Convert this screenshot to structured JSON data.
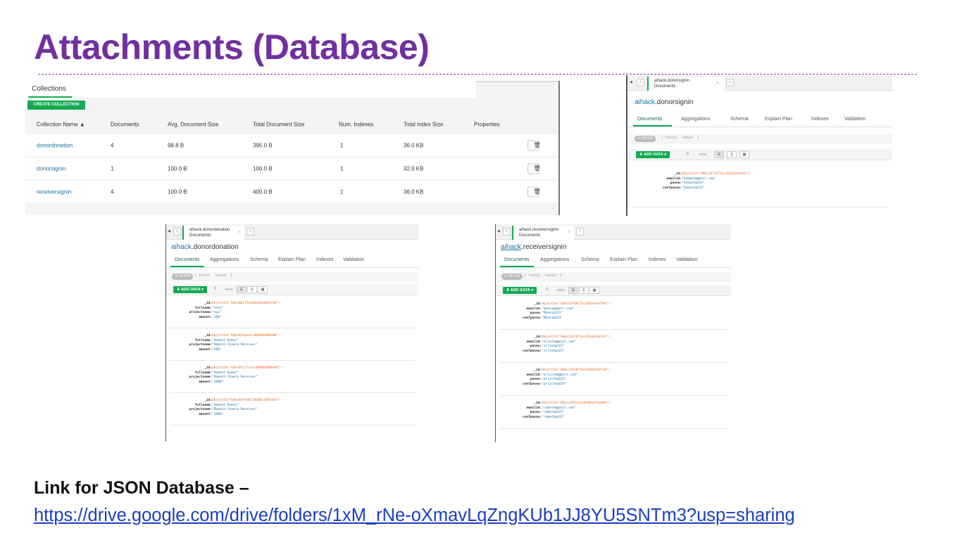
{
  "slide": {
    "title": "Attachments (Database)",
    "link_heading": "Link for JSON Database –",
    "link_url": "https://drive.google.com/drive/folders/1xM_rNe-oXmavLqZngKUb1JJ8YU5SNTm3?usp=sharing"
  },
  "collections": {
    "tab_label": "Collections",
    "create_button": "CREATE COLLECTION",
    "columns": [
      "Collection Name ▲",
      "Documents",
      "Avg. Document Size",
      "Total Document Size",
      "Num. Indexes",
      "Total Index Size",
      "Properties"
    ],
    "rows": [
      {
        "name": "donordonation",
        "documents": "4",
        "avg_size": "98.8 B",
        "total_size": "395.0 B",
        "indexes": "1",
        "index_size": "36.0 KB"
      },
      {
        "name": "donorsignin",
        "documents": "1",
        "avg_size": "100.0 B",
        "total_size": "100.0 B",
        "indexes": "1",
        "index_size": "32.0 KB"
      },
      {
        "name": "receiversignin",
        "documents": "4",
        "avg_size": "100.0 B",
        "total_size": "400.0 B",
        "indexes": "1",
        "index_size": "36.0 KB"
      }
    ],
    "delete_icon": "trash-icon"
  },
  "windows": {
    "donorsignin": {
      "tab_title": "aihack.donorsignin",
      "tab_sub": "Documents",
      "db": "aihack",
      "collection": ".donorsignin",
      "tabs": [
        "Documents",
        "Aggregations",
        "Schema",
        "Explain Plan",
        "Indexes",
        "Validation"
      ],
      "filter_label": "⊙ FILTER",
      "filter_placeholder": "{ field: 'value' }",
      "add_data": "⬇ ADD DATA ▾",
      "view_label": "VIEW",
      "documents": [
        [
          {
            "k": "_id:",
            "v": "ObjectId(\"60dc2377072ac456b43e87da\")",
            "t": "oid"
          },
          {
            "k": "emailid:",
            "v": "\"hemant@gmail.com\"",
            "t": "s"
          },
          {
            "k": "passw:",
            "v": "\"hemant@123\"",
            "t": "s"
          },
          {
            "k": "confpassw:",
            "v": "\"hemant@123\"",
            "t": "s"
          }
        ]
      ]
    },
    "donordonation": {
      "tab_title": "aihack.donordonation",
      "tab_sub": "Documents",
      "db": "aihack",
      "collection": ".donordonation",
      "tabs": [
        "Documents",
        "Aggregations",
        "Schema",
        "Explain Plan",
        "Indexes",
        "Validation"
      ],
      "filter_label": "⊙ FILTER",
      "filter_placeholder": "{ field: 'value' }",
      "add_data": "⬇ ADD DATA ▾",
      "view_label": "VIEW",
      "documents": [
        [
          {
            "k": "_id:",
            "v": "ObjectId(\"60ea8817fea80ea6340a9f00\")",
            "t": "oid"
          },
          {
            "k": "fullname:",
            "v": "\"text\"",
            "t": "s"
          },
          {
            "k": "projectname:",
            "v": "\"xyz\"",
            "t": "s"
          },
          {
            "k": "amount:",
            "v": "\"100\"",
            "t": "s"
          }
        ],
        [
          {
            "k": "_id:",
            "v": "ObjectId(\"60ea93daea2c0000b6000d06\")",
            "t": "oid"
          },
          {
            "k": "fullname:",
            "v": "\"Hemant Kumar\"",
            "t": "s"
          },
          {
            "k": "projectname:",
            "v": "\"Ramesh Chawla Receiver\"",
            "t": "s"
          },
          {
            "k": "amount:",
            "v": "\"500\"",
            "t": "s"
          }
        ],
        [
          {
            "k": "_id:",
            "v": "ObjectId(\"60ea9f1c7aa2c0000b6000d05\")",
            "t": "oid"
          },
          {
            "k": "fullname:",
            "v": "\"Hemant Kumar\"",
            "t": "s"
          },
          {
            "k": "projectname:",
            "v": "\"Ramesh Chawla Receiver\"",
            "t": "s"
          },
          {
            "k": "amount:",
            "v": "\"1000\"",
            "t": "s"
          }
        ],
        [
          {
            "k": "_id:",
            "v": "ObjectId(\"60ea9a9fd6570000c3007db4\")",
            "t": "oid"
          },
          {
            "k": "fullname:",
            "v": "\"Hemant Kumar\"",
            "t": "s"
          },
          {
            "k": "projectname:",
            "v": "\"Ramesh Chawla Receiver\"",
            "t": "s"
          },
          {
            "k": "amount:",
            "v": "\"1000\"",
            "t": "s"
          }
        ]
      ]
    },
    "receiversignin": {
      "tab_title": "aihack.receiversignin",
      "tab_sub": "Documents",
      "db": "aihack",
      "collection": ".receiversignin",
      "tabs": [
        "Documents",
        "Aggregations",
        "Schema",
        "Explain Plan",
        "Indexes",
        "Validation"
      ],
      "filter_label": "⊙ FILTER",
      "filter_placeholder": "{ field: 'value' }",
      "add_data": "⬇ ADD DATA ▾",
      "view_label": "VIEW",
      "documents": [
        [
          {
            "k": "_id:",
            "v": "ObjectId(\"60dc2476072ac456b43e87db\")",
            "t": "oid"
          },
          {
            "k": "emailid:",
            "v": "\"manoj@gmail.com\"",
            "t": "s"
          },
          {
            "k": "passw:",
            "v": "\"Manoj@123\"",
            "t": "s"
          },
          {
            "k": "confpassw:",
            "v": "\"Manoj@123\"",
            "t": "s"
          }
        ],
        [
          {
            "k": "_id:",
            "v": "ObjectId(\"60dc2447072ac456b43e87dc\")",
            "t": "oid"
          },
          {
            "k": "emailid:",
            "v": "\"nilesh@gmail.com\"",
            "t": "s"
          },
          {
            "k": "passw:",
            "v": "\"nilesh@123\"",
            "t": "s"
          },
          {
            "k": "confpassw:",
            "v": "\"nilesh@123\"",
            "t": "s"
          }
        ],
        [
          {
            "k": "_id:",
            "v": "ObjectId(\"60dc244e072ac456b43e87dd\")",
            "t": "oid"
          },
          {
            "k": "emailid:",
            "v": "\"prijith@gmail.com\"",
            "t": "s"
          },
          {
            "k": "passw:",
            "v": "\"prijith@123\"",
            "t": "s"
          },
          {
            "k": "confpassw:",
            "v": "\"prijith@123\"",
            "t": "s"
          }
        ],
        [
          {
            "k": "_id:",
            "v": "ObjectId(\"60eac6361e7ed599a734a666\")",
            "t": "oid"
          },
          {
            "k": "emailid:",
            "v": "\"ramesh@gmail.com\"",
            "t": "s"
          },
          {
            "k": "passw:",
            "v": "\"ramesh@123\"",
            "t": "s"
          },
          {
            "k": "confpassw:",
            "v": "\"ramesh@123\"",
            "t": "s"
          }
        ]
      ]
    }
  },
  "colors": {
    "title": "#7030a0",
    "accent_green": "#13aa52",
    "link_blue": "#1d6fa5",
    "objectid_orange": "#e06c2a"
  }
}
